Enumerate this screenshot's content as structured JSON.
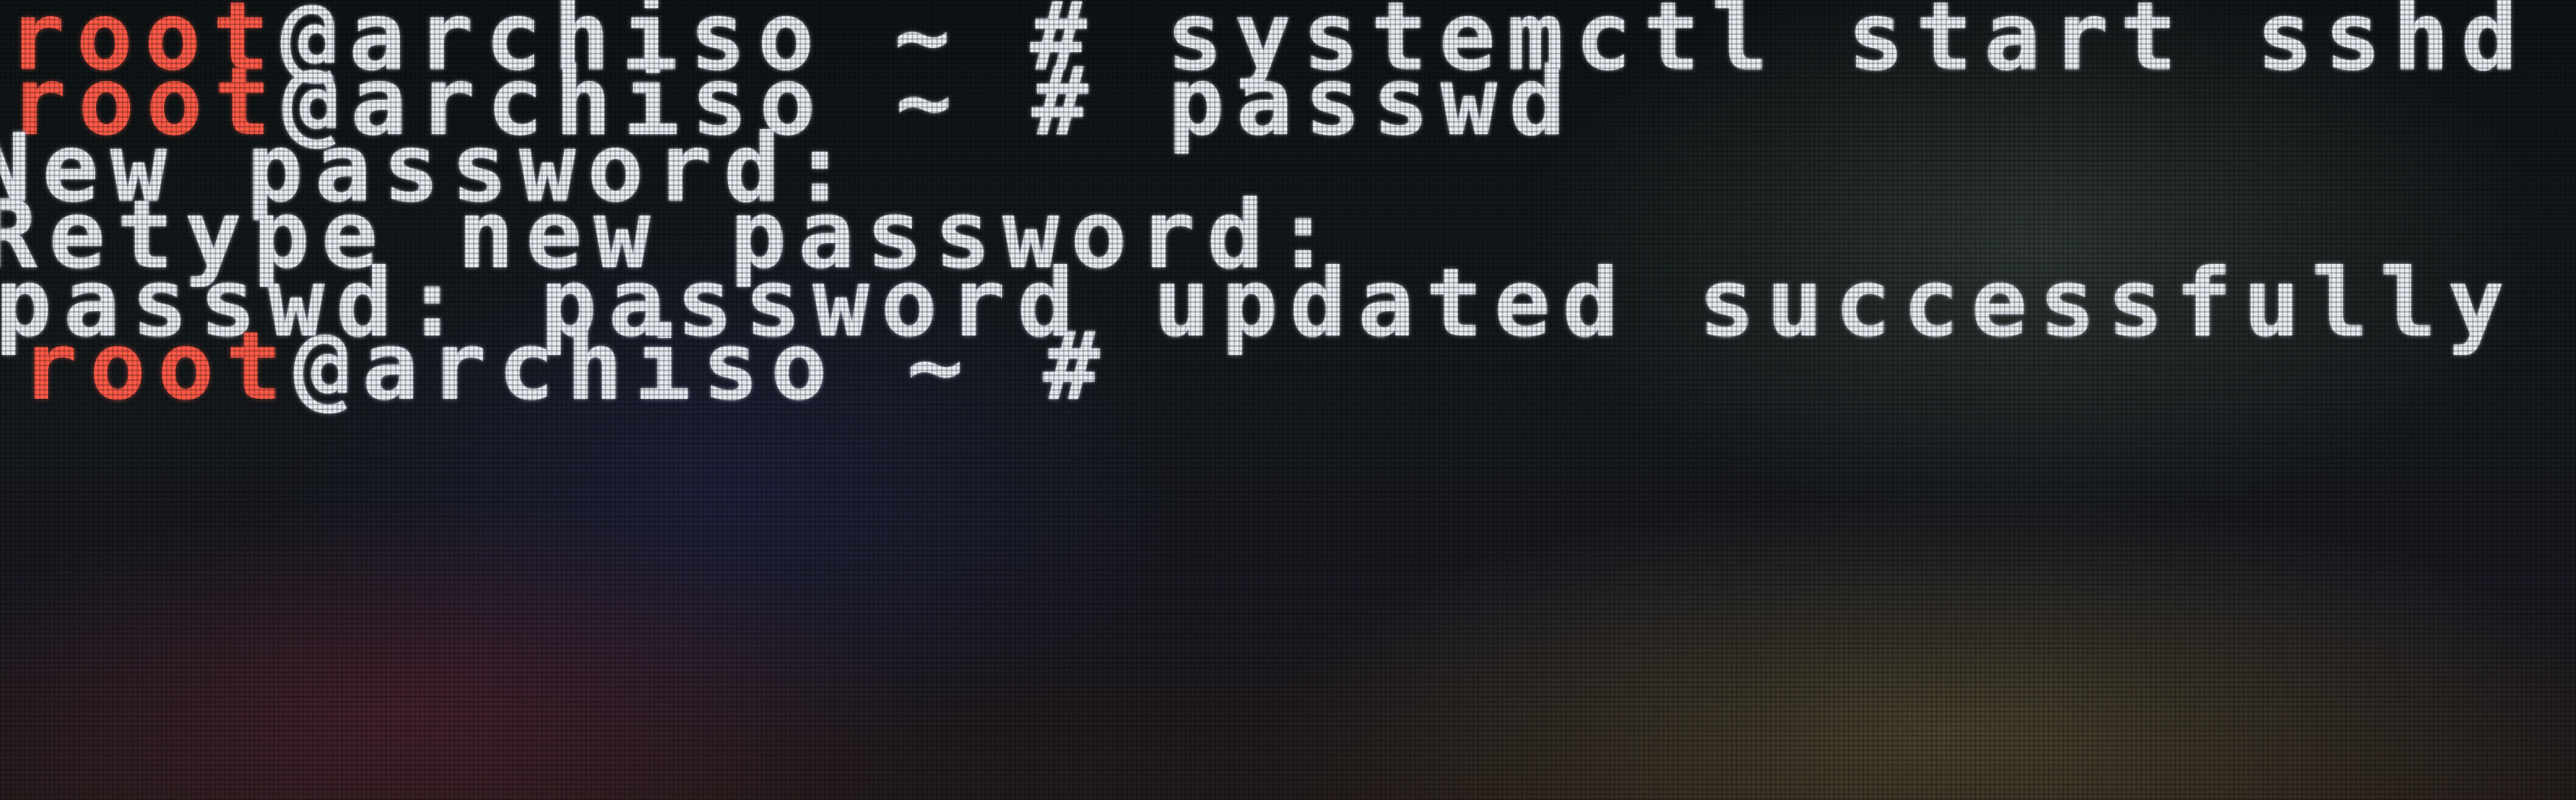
{
  "terminal": {
    "lines": [
      {
        "user": "root",
        "host_part": "@archiso",
        "tilde": "~",
        "hash": "#",
        "command": "systemctl start sshd"
      },
      {
        "user": "root",
        "host_part": "@archiso",
        "tilde": "~",
        "hash": "#",
        "command": "passwd"
      },
      {
        "output": "New password:"
      },
      {
        "output": "Retype new password:"
      },
      {
        "output": "passwd: password updated successfully"
      },
      {
        "user": "root",
        "host_part": "@archiso",
        "tilde": "~",
        "hash": "#",
        "command": ""
      }
    ]
  },
  "colors": {
    "prompt_user": "#ff5a48",
    "text": "#e8ecf2",
    "background": "#0d1012"
  }
}
